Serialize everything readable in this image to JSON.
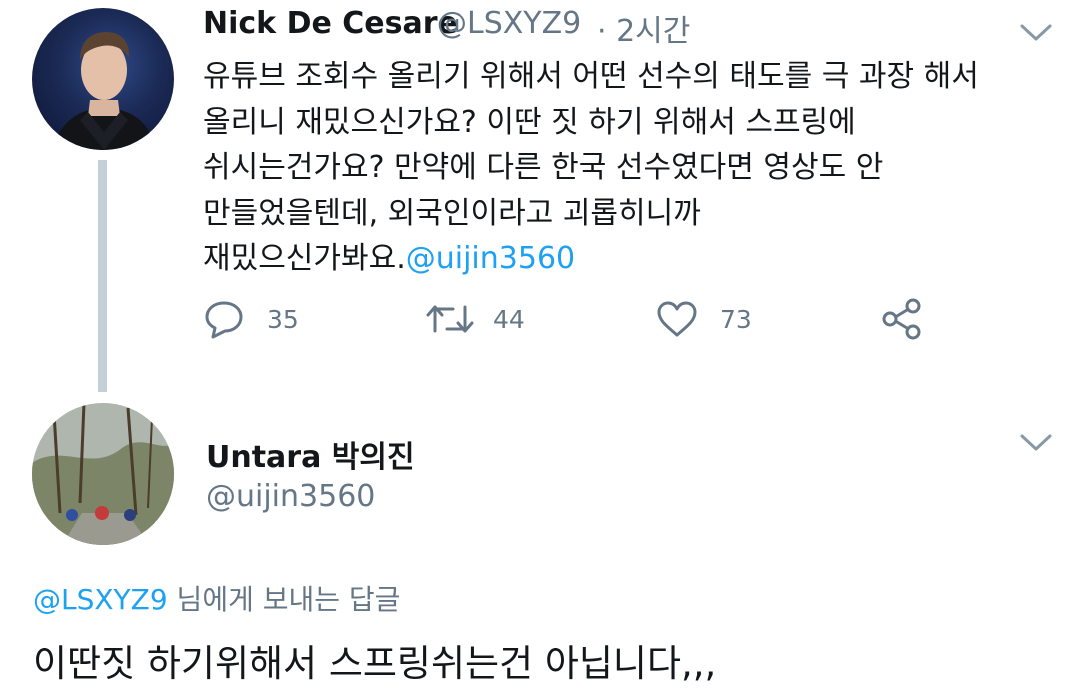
{
  "tweet": {
    "author_name": "Nick De Cesare",
    "author_handle": "@LSXYZ9",
    "time": "· 2시간",
    "lines": [
      "유튜브 조회수 올리기 위해서 어떤 선수의 태도를 극 과장 해서",
      "올리니 재밌으신가요? 이딴 짓 하기 위해서 스프링에",
      "쉬시는건가요? 만약에 다른 한국 선수였다면 영상도 안",
      "만들었을텐데, 외국인이라고 괴롭히니까"
    ],
    "last_line_text": "재밌으신가봐요.",
    "mention": "@uijin3560",
    "actions": {
      "reply_count": "35",
      "retweet_count": "44",
      "like_count": "73"
    }
  },
  "reply": {
    "author_name": "Untara 박의진",
    "author_handle": "@uijin3560",
    "replying_to_handle": "@LSXYZ9",
    "replying_to_suffix": " 님에게 보내는 답글",
    "text": "이딴짓 하기위해서 스프링쉬는건 아닙니다,,,"
  },
  "icons": {
    "reply": "reply-icon",
    "retweet": "retweet-icon",
    "like": "heart-icon",
    "share": "share-icon",
    "menu": "chevron-down-icon"
  },
  "colors": {
    "link": "#1da1f2",
    "secondary_text": "#657786",
    "thread_line": "#c4cfd6"
  }
}
